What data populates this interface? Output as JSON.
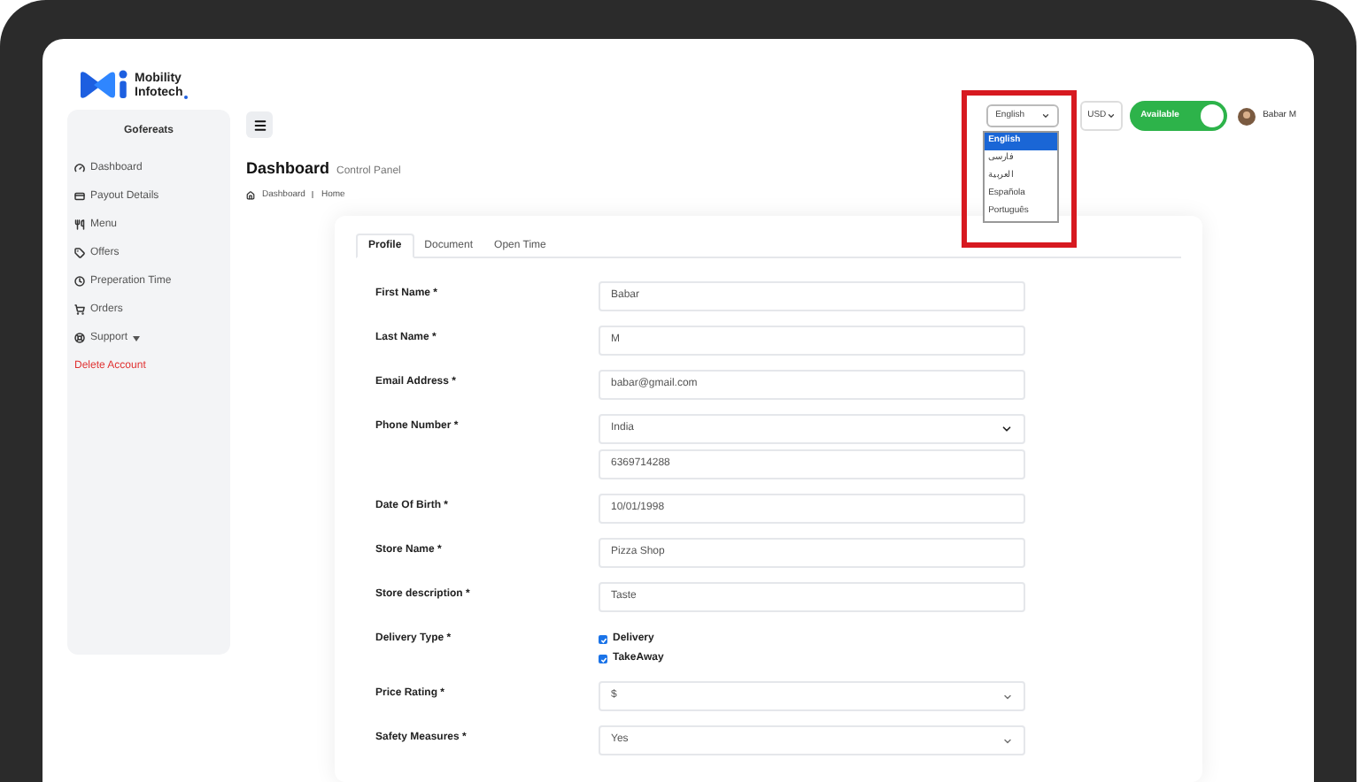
{
  "logo": {
    "line_1": "Mobility",
    "line_2": "Infotech"
  },
  "sidebar": {
    "title": "Gofereats",
    "items": [
      {
        "label": "Dashboard",
        "kind": "link"
      },
      {
        "label": "Payout Details",
        "kind": "link"
      },
      {
        "label": "Menu",
        "kind": "link"
      },
      {
        "label": "Offers",
        "kind": "link"
      },
      {
        "label": "Preperation Time",
        "kind": "link"
      },
      {
        "label": "Orders",
        "kind": "link"
      },
      {
        "label": "Support",
        "kind": "dropdown"
      },
      {
        "label": "Delete Account",
        "kind": "danger"
      }
    ]
  },
  "header": {
    "language_select": {
      "value": "English",
      "expanded": true,
      "highlighted": true,
      "options": [
        {
          "label": "English",
          "selected": true
        },
        {
          "label": "فارسی",
          "selected": false
        },
        {
          "label": "العربية",
          "selected": false
        },
        {
          "label": "Española",
          "selected": false
        },
        {
          "label": "Português",
          "selected": false
        }
      ]
    },
    "currency_select": {
      "value": "USD"
    },
    "availability": {
      "label": "Available",
      "on": true
    },
    "user": {
      "name": "Babar M"
    }
  },
  "page": {
    "title": "Dashboard",
    "subtitle": "Control Panel",
    "breadcrumb": [
      "Dashboard",
      "Home"
    ]
  },
  "tabs": [
    {
      "label": "Profile",
      "selected": true
    },
    {
      "label": "Document",
      "selected": false
    },
    {
      "label": "Open Time",
      "selected": false
    }
  ],
  "form": {
    "fields": [
      {
        "label": "First Name *",
        "kind": "text",
        "value": "Babar"
      },
      {
        "label": "Last Name *",
        "kind": "text",
        "value": "M"
      },
      {
        "label": "Email Address *",
        "kind": "text",
        "value": "babar@gmail.com"
      },
      {
        "label": "Phone Number *",
        "kind": "phone",
        "country": "India",
        "value": "6369714288"
      },
      {
        "label": "Date Of Birth *",
        "kind": "text",
        "value": "10/01/1998"
      },
      {
        "label": "Store Name *",
        "kind": "text",
        "value": "Pizza Shop"
      },
      {
        "label": "Store description *",
        "kind": "text",
        "value": "Taste"
      },
      {
        "label": "Delivery Type *",
        "kind": "checkboxes",
        "options": [
          {
            "label": "Delivery",
            "checked": true
          },
          {
            "label": "TakeAway",
            "checked": true
          }
        ]
      },
      {
        "label": "Price Rating *",
        "kind": "select",
        "value": "$"
      },
      {
        "label": "Safety Measures *",
        "kind": "select",
        "value": "Yes"
      }
    ]
  }
}
